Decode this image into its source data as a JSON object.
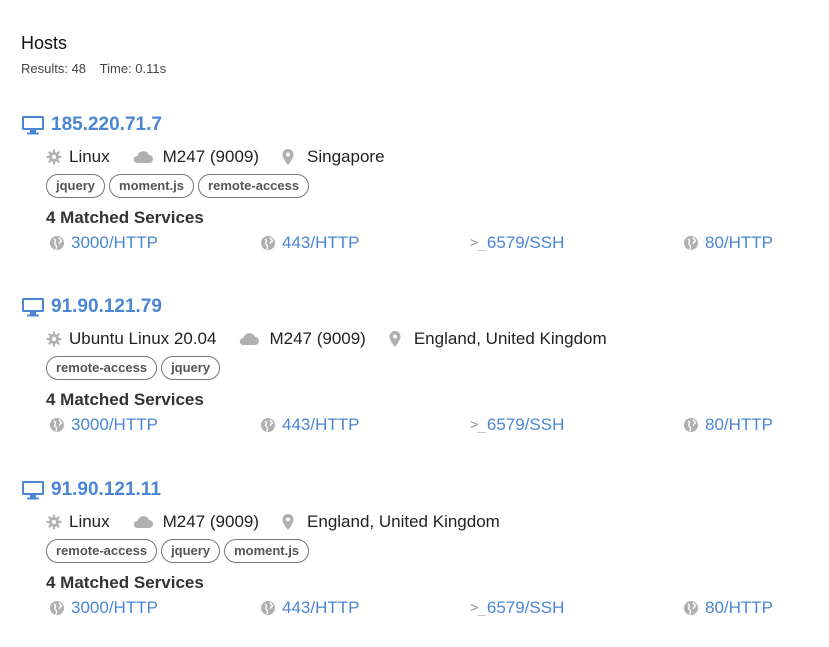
{
  "header": {
    "title": "Hosts",
    "results_text": "Results: 48",
    "time_text": "Time: 0.11s"
  },
  "colors": {
    "link": "#4a86d4",
    "icon_grey": "#b0b0b0",
    "tag_border": "#777777"
  },
  "hosts": [
    {
      "ip": "185.220.71.7",
      "os": "Linux",
      "asn": "M247 (9009)",
      "location": "Singapore",
      "tags": [
        "jquery",
        "moment.js",
        "remote-access"
      ],
      "matched_label": "4 Matched Services",
      "services": [
        {
          "label": "3000/HTTP",
          "icon": "globe-icon"
        },
        {
          "label": "443/HTTP",
          "icon": "globe-icon"
        },
        {
          "label": "6579/SSH",
          "icon": "terminal-icon"
        },
        {
          "label": "80/HTTP",
          "icon": "globe-icon"
        }
      ]
    },
    {
      "ip": "91.90.121.79",
      "os": "Ubuntu Linux 20.04",
      "asn": "M247 (9009)",
      "location": "England, United Kingdom",
      "tags": [
        "remote-access",
        "jquery"
      ],
      "matched_label": "4 Matched Services",
      "services": [
        {
          "label": "3000/HTTP",
          "icon": "globe-icon"
        },
        {
          "label": "443/HTTP",
          "icon": "globe-icon"
        },
        {
          "label": "6579/SSH",
          "icon": "terminal-icon"
        },
        {
          "label": "80/HTTP",
          "icon": "globe-icon"
        }
      ]
    },
    {
      "ip": "91.90.121.11",
      "os": "Linux",
      "asn": "M247 (9009)",
      "location": "England, United Kingdom",
      "tags": [
        "remote-access",
        "jquery",
        "moment.js"
      ],
      "matched_label": "4 Matched Services",
      "services": [
        {
          "label": "3000/HTTP",
          "icon": "globe-icon"
        },
        {
          "label": "443/HTTP",
          "icon": "globe-icon"
        },
        {
          "label": "6579/SSH",
          "icon": "terminal-icon"
        },
        {
          "label": "80/HTTP",
          "icon": "globe-icon"
        }
      ]
    }
  ]
}
